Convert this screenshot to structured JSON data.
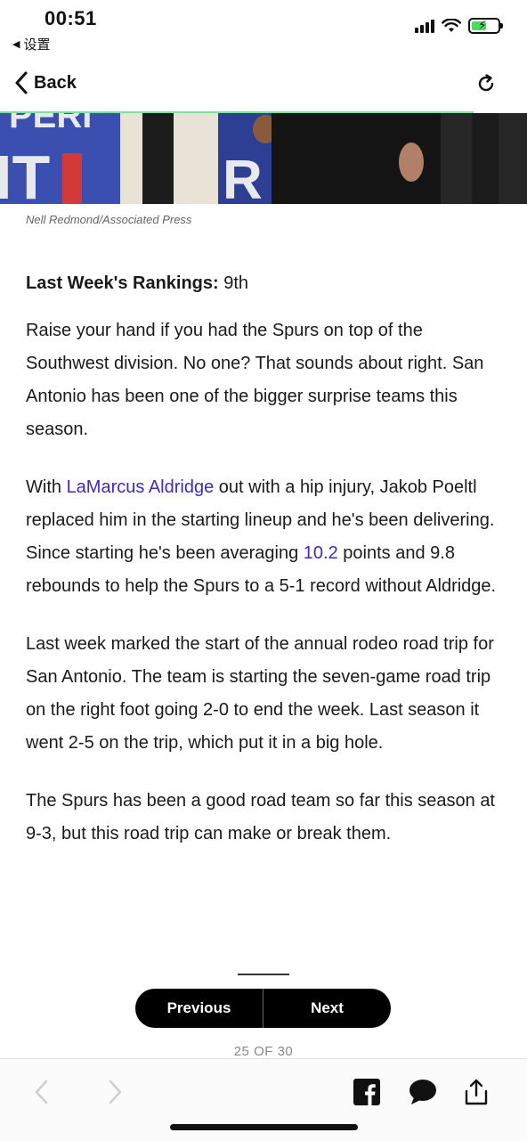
{
  "status_bar": {
    "time": "00:51",
    "back_app": "设置",
    "battery_color": "#4cd964"
  },
  "nav": {
    "back_label": "Back",
    "back_icon": "chevron-left-icon",
    "reload_icon": "reload-icon",
    "progress_color": "#7ee0a0"
  },
  "hero": {
    "photo_credit": "Nell Redmond/Associated Press"
  },
  "article": {
    "rank_label": "Last Week's Rankings:",
    "rank_value": " 9th",
    "p1": "Raise your hand if you had the Spurs on top of the Southwest division. No one? That sounds about right. San Antonio has been one of the bigger surprise teams this season.",
    "p2_pre": "With ",
    "p2_link": "LaMarcus Aldridge",
    "p2_mid": " out with a hip injury, Jakob Poeltl replaced him in the starting lineup and he's been delivering. Since starting he's been averaging ",
    "p2_link2": "10.2",
    "p2_post": " points and 9.8 rebounds to help the Spurs to a 5-1 record without Aldridge.",
    "p3": "Last week marked the start of the annual rodeo road trip for San Antonio. The team is starting the seven-game road trip on the right foot going 2-0 to end the week. Last season it went 2-5 on the trip, which put it in a big hole.",
    "p4": "The Spurs has been a good road team so far this season at 9-3, but this road trip can make or break them.",
    "link_color": "#3b2bc4"
  },
  "pager": {
    "previous_label": "Previous",
    "next_label": "Next",
    "counter": "25 OF 30"
  },
  "toolbar": {
    "icons": [
      "back-arrow-icon",
      "forward-arrow-icon",
      "facebook-icon",
      "comment-icon",
      "share-icon"
    ]
  }
}
